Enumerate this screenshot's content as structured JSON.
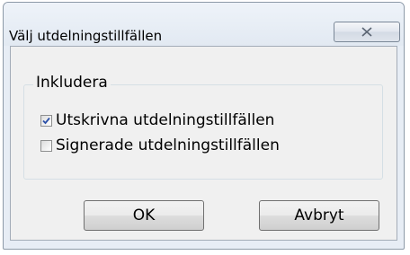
{
  "dialog": {
    "title": "Välj utdelningstillfällen",
    "close_icon": "close-icon"
  },
  "group": {
    "label": "Inkludera",
    "options": [
      {
        "label": "Utskrivna utdelningstillfällen",
        "checked": true
      },
      {
        "label": "Signerade utdelningstillfällen",
        "checked": false
      }
    ]
  },
  "buttons": {
    "ok_label": "OK",
    "cancel_label": "Avbryt"
  }
}
